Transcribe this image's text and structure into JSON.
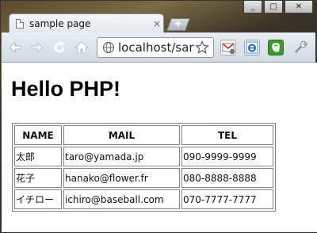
{
  "window": {
    "controls": {
      "minimize": "_",
      "maximize": "□",
      "close": "✕"
    }
  },
  "tab": {
    "title": "sample page",
    "close": "×"
  },
  "new_tab": "+",
  "toolbar": {
    "back_icon": "arrow-left",
    "forward_icon": "arrow-right",
    "reload_icon": "reload",
    "home_icon": "home",
    "url": "localhost/sar",
    "star_icon": "star",
    "extensions": [
      "gmail-checker",
      "ie-tab",
      "evernote"
    ],
    "wrench_icon": "wrench"
  },
  "page": {
    "heading": "Hello PHP!",
    "table": {
      "headers": [
        "NAME",
        "MAIL",
        "TEL"
      ],
      "rows": [
        [
          "太郎",
          "taro@yamada.jp",
          "090-9999-9999"
        ],
        [
          "花子",
          "hanako@flower.fr",
          "080-8888-8888"
        ],
        [
          "イチロー",
          "ichiro@baseball.com",
          "070-7777-7777"
        ]
      ]
    }
  }
}
